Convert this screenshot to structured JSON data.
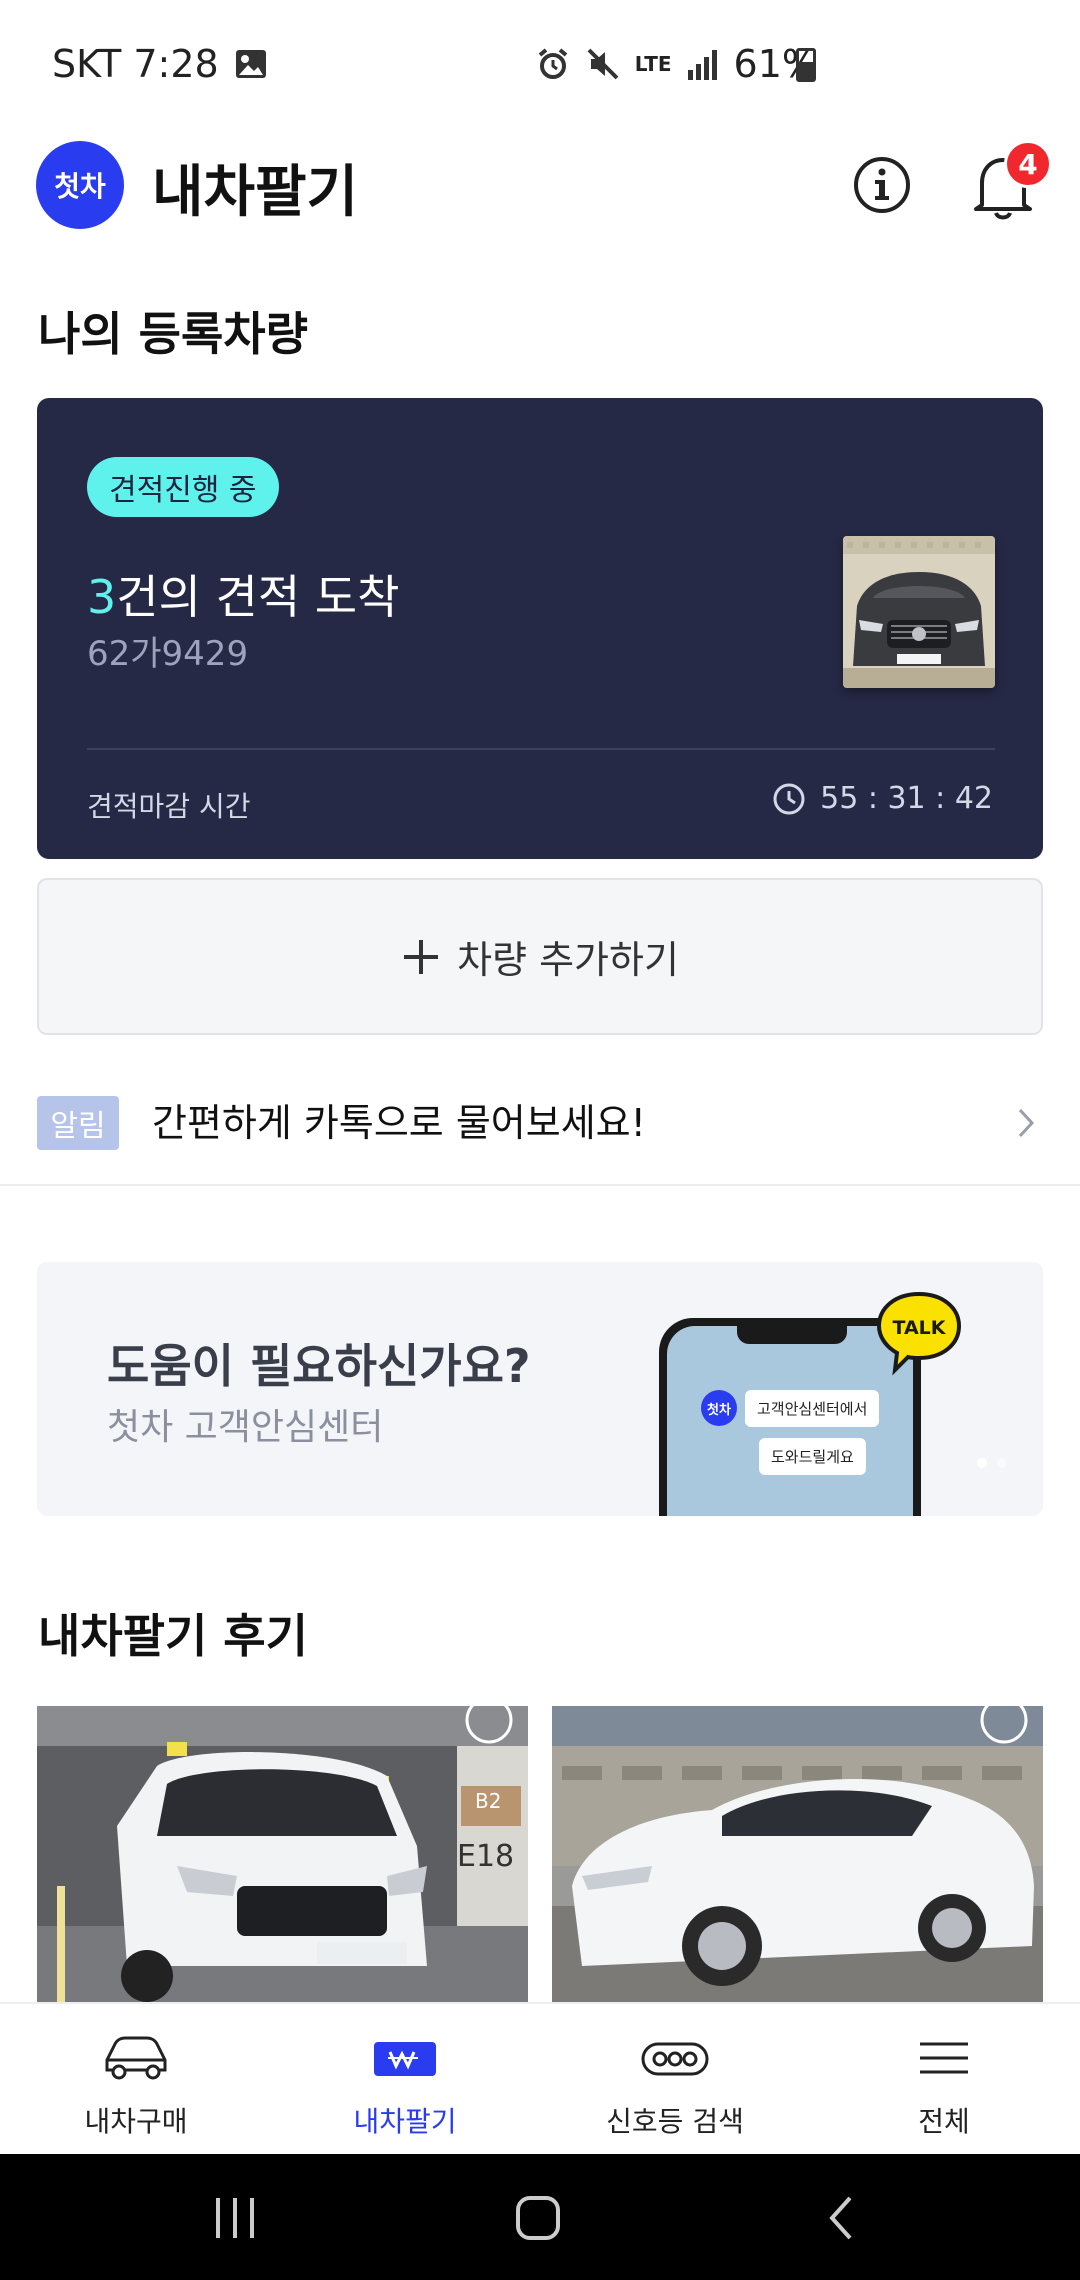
{
  "status_bar": {
    "carrier_time": "SKT 7:28",
    "network": "LTE",
    "battery": "61%"
  },
  "header": {
    "logo_text": "첫차",
    "title": "내차팔기",
    "notification_count": "4"
  },
  "my_cars": {
    "section_title": "나의 등록차량",
    "card": {
      "status_pill": "견적진행 중",
      "quote_count": "3",
      "quote_suffix": "건의 견적 도착",
      "plate": "62가9429",
      "deadline_label": "견적마감 시간",
      "deadline_timer": "55 : 31 : 42"
    },
    "add_button_label": "차량 추가하기"
  },
  "notice": {
    "tag": "알림",
    "message": "간편하게 카톡으로 물어보세요!"
  },
  "banner": {
    "title": "도움이 필요하신가요?",
    "subtitle": "첫차 고객안심센터",
    "phone_avatar": "첫차",
    "bubble_1": "고객안심센터에서",
    "bubble_2": "도와드릴게요",
    "talk_label": "TALK"
  },
  "reviews": {
    "section_title": "내차팔기 후기"
  },
  "tab_bar": {
    "tabs": [
      {
        "label": "내차구매",
        "icon": "car-icon"
      },
      {
        "label": "내차팔기",
        "icon": "won-icon"
      },
      {
        "label": "신호등 검색",
        "icon": "traffic-light-icon"
      },
      {
        "label": "전체",
        "icon": "menu-icon"
      }
    ],
    "active_index": 1
  },
  "colors": {
    "brand_blue": "#2a3cf0",
    "card_bg": "#262946",
    "accent_cyan": "#5ff2ec",
    "badge_red": "#f0282d"
  }
}
